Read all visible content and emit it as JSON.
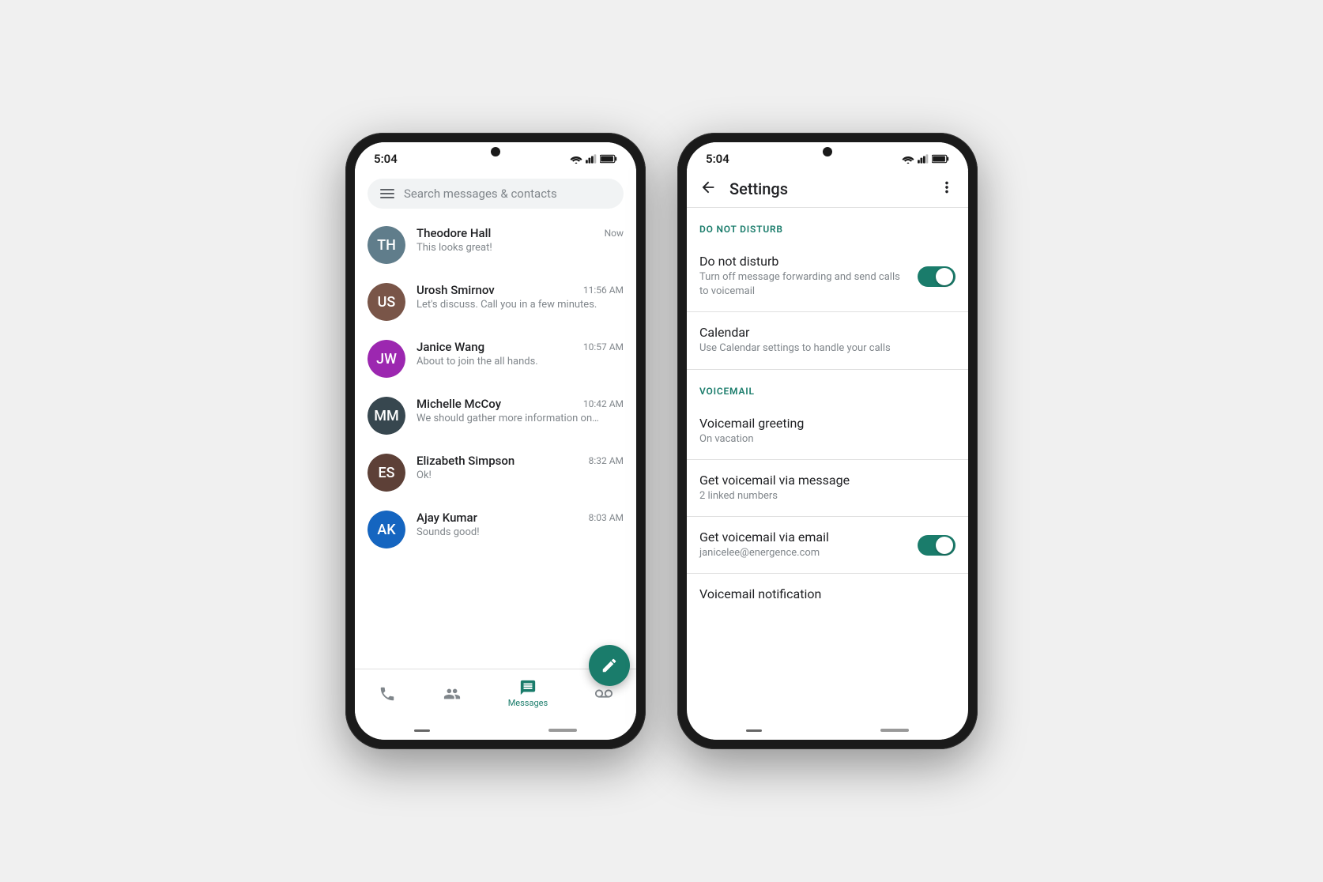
{
  "phone1": {
    "statusBar": {
      "time": "5:04"
    },
    "searchBar": {
      "placeholder": "Search messages & contacts"
    },
    "contacts": [
      {
        "id": "1",
        "name": "Theodore Hall",
        "message": "This looks great!",
        "time": "Now",
        "initials": "TH",
        "avatarColor": "avatar-1"
      },
      {
        "id": "2",
        "name": "Urosh Smirnov",
        "message": "Let's discuss. Call you in a few minutes.",
        "time": "11:56 AM",
        "initials": "US",
        "avatarColor": "avatar-2"
      },
      {
        "id": "3",
        "name": "Janice Wang",
        "message": "About to join the all hands.",
        "time": "10:57 AM",
        "initials": "JW",
        "avatarColor": "avatar-3"
      },
      {
        "id": "4",
        "name": "Michelle McCoy",
        "message": "We should gather more information on…",
        "time": "10:42 AM",
        "initials": "MM",
        "avatarColor": "avatar-4"
      },
      {
        "id": "5",
        "name": "Elizabeth Simpson",
        "message": "Ok!",
        "time": "8:32 AM",
        "initials": "ES",
        "avatarColor": "avatar-5"
      },
      {
        "id": "6",
        "name": "Ajay Kumar",
        "message": "Sounds good!",
        "time": "8:03 AM",
        "initials": "AK",
        "avatarColor": "avatar-6"
      }
    ],
    "bottomNav": {
      "items": [
        {
          "label": "",
          "icon": "phone",
          "active": false
        },
        {
          "label": "",
          "icon": "contacts",
          "active": false
        },
        {
          "label": "Messages",
          "icon": "messages",
          "active": true
        },
        {
          "label": "",
          "icon": "voicemail",
          "active": false
        }
      ]
    }
  },
  "phone2": {
    "statusBar": {
      "time": "5:04"
    },
    "header": {
      "title": "Settings"
    },
    "sections": [
      {
        "id": "doNotDisturb",
        "sectionLabel": "DO NOT DISTURB",
        "items": [
          {
            "id": "dnd",
            "title": "Do not disturb",
            "subtitle": "Turn off message forwarding and send calls to voicemail",
            "toggle": true,
            "toggleState": "on"
          },
          {
            "id": "calendar",
            "title": "Calendar",
            "subtitle": "Use Calendar settings to handle your calls",
            "toggle": false,
            "toggleState": null
          }
        ]
      },
      {
        "id": "voicemail",
        "sectionLabel": "VOICEMAIL",
        "items": [
          {
            "id": "voicemailGreeting",
            "title": "Voicemail greeting",
            "subtitle": "On vacation",
            "toggle": false,
            "toggleState": null
          },
          {
            "id": "voicemailViaMessage",
            "title": "Get voicemail via message",
            "subtitle": "2 linked numbers",
            "toggle": false,
            "toggleState": null
          },
          {
            "id": "voicemailViaEmail",
            "title": "Get voicemail via email",
            "subtitle": "janicelee@energence.com",
            "toggle": true,
            "toggleState": "on"
          },
          {
            "id": "voicemailNotification",
            "title": "Voicemail notification",
            "subtitle": "",
            "toggle": false,
            "toggleState": null
          }
        ]
      }
    ]
  }
}
